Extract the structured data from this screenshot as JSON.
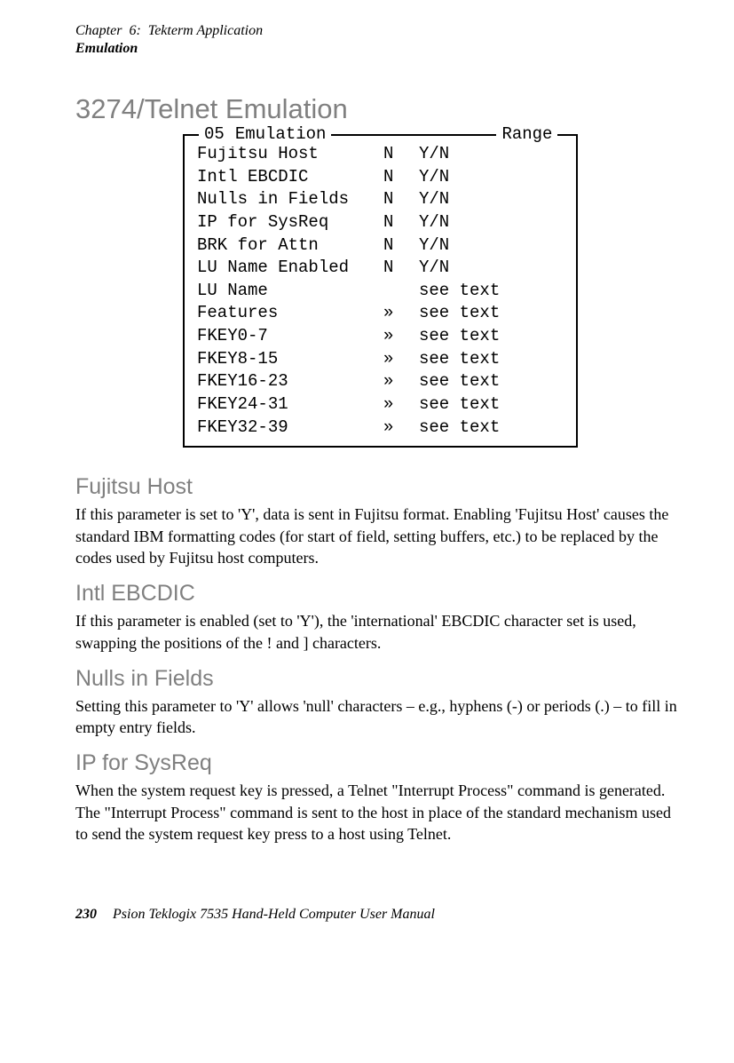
{
  "header": {
    "chapter": "Chapter  6:  Tekterm Application",
    "section": "Emulation"
  },
  "title": "3274/Telnet Emulation",
  "box": {
    "num": "05",
    "label": "Emulation",
    "rangeLabel": "Range",
    "rows": [
      {
        "label": "Fujitsu Host",
        "val": "N",
        "range": "Y/N"
      },
      {
        "label": "Intl EBCDIC",
        "val": "N",
        "range": "Y/N"
      },
      {
        "label": "Nulls in Fields",
        "val": "N",
        "range": "Y/N"
      },
      {
        "label": "IP for SysReq",
        "val": "N",
        "range": "Y/N"
      },
      {
        "label": "BRK for Attn",
        "val": "N",
        "range": "Y/N"
      },
      {
        "label": "LU Name Enabled",
        "val": "N",
        "range": "Y/N"
      },
      {
        "label": "LU Name",
        "val": "",
        "range": "see text"
      },
      {
        "label": "Features",
        "val": "»",
        "range": "see text"
      },
      {
        "label": "FKEY0-7",
        "val": "»",
        "range": "see text"
      },
      {
        "label": "FKEY8-15",
        "val": "»",
        "range": "see text"
      },
      {
        "label": "FKEY16-23",
        "val": "»",
        "range": "see text"
      },
      {
        "label": "FKEY24-31",
        "val": "»",
        "range": "see text"
      },
      {
        "label": "FKEY32-39",
        "val": "»",
        "range": "see text"
      }
    ]
  },
  "sections": [
    {
      "heading": "Fujitsu Host",
      "body": "If this parameter is set to 'Y', data is sent in Fujitsu format. Enabling 'Fujitsu Host' causes the standard IBM formatting codes (for start of field, setting buffers, etc.) to be replaced by the codes used by Fujitsu host computers."
    },
    {
      "heading": "Intl EBCDIC",
      "body": "If this parameter is enabled (set to 'Y'), the 'international' EBCDIC character set is used, swapping the positions of the ! and ] characters."
    },
    {
      "heading": "Nulls in Fields",
      "body": "Setting this parameter to 'Y' allows 'null' characters – e.g., hyphens (-) or periods (.) – to fill in empty entry fields."
    },
    {
      "heading": "IP for SysReq",
      "body": "When the system request key is pressed, a Telnet \"Interrupt Process\" command is generated. The \"Interrupt Process\" command is sent to the host in place of the standard mechanism used to send the system request key press to a host using Telnet."
    }
  ],
  "footer": {
    "page": "230",
    "text": "Psion Teklogix 7535 Hand-Held Computer User Manual"
  }
}
